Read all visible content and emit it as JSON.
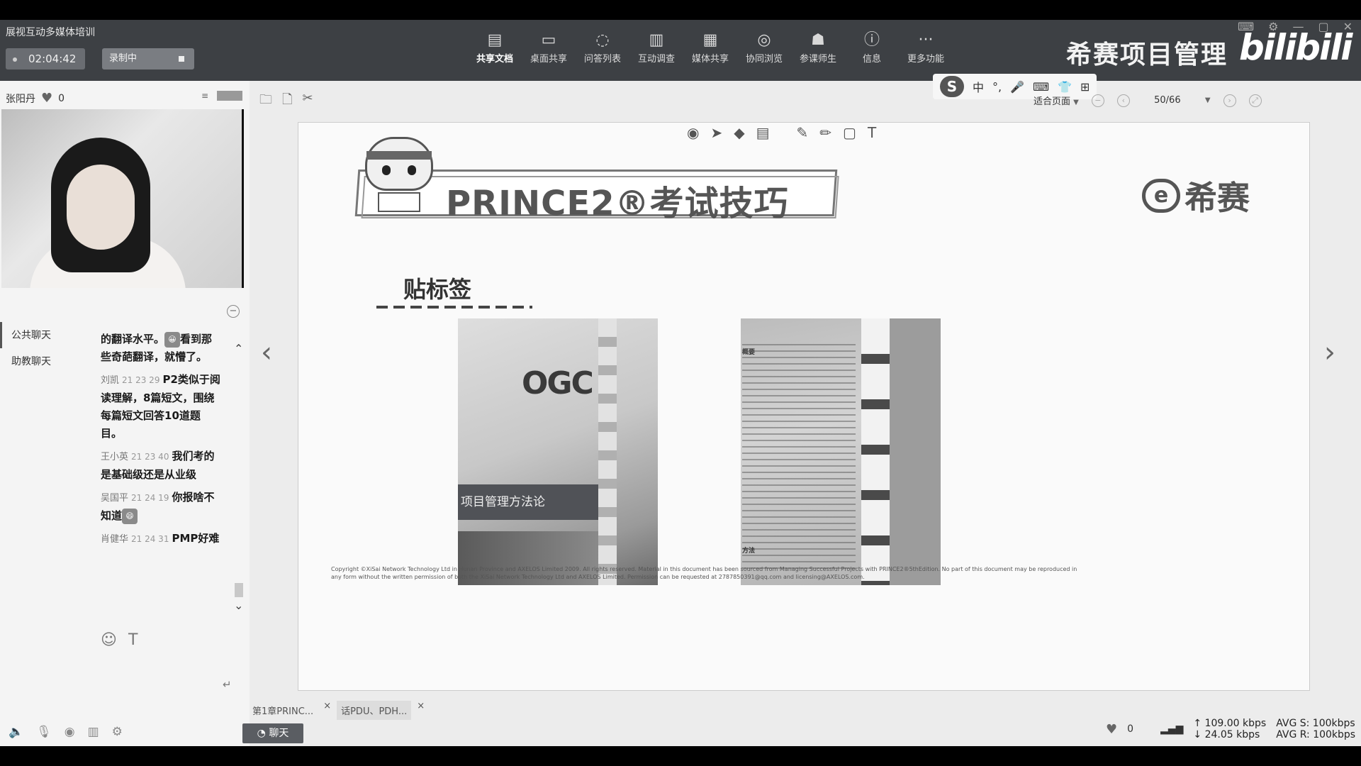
{
  "app": {
    "title": "展视互动多媒体培训",
    "timer": "02:04:42",
    "record_label": "录制中"
  },
  "toolbar": {
    "items": [
      {
        "label": "共享文档",
        "icon": "share-doc-icon",
        "glyph": "▤"
      },
      {
        "label": "桌面共享",
        "icon": "desktop-share-icon",
        "glyph": "▭"
      },
      {
        "label": "问答列表",
        "icon": "qa-list-icon",
        "glyph": "◌"
      },
      {
        "label": "互动调查",
        "icon": "survey-icon",
        "glyph": "▥"
      },
      {
        "label": "媒体共享",
        "icon": "media-share-icon",
        "glyph": "▦"
      },
      {
        "label": "协同浏览",
        "icon": "co-browse-icon",
        "glyph": "◎"
      },
      {
        "label": "参课师生",
        "icon": "participants-icon",
        "glyph": "☗"
      },
      {
        "label": "信息",
        "icon": "info-icon",
        "glyph": "ⓘ"
      },
      {
        "label": "更多功能",
        "icon": "more-icon",
        "glyph": "···"
      }
    ]
  },
  "brand": {
    "text": "希赛项目管理",
    "watermark": "bilibili"
  },
  "presenter": {
    "name": "张阳丹",
    "likes": "0"
  },
  "chat": {
    "tabs": [
      "公共聊天",
      "助教聊天"
    ],
    "messages": [
      {
        "who": "",
        "time": "",
        "text": "的翻译水平。",
        "emoji": "😀",
        "text2": "看到那些奇葩翻译，就懵了。"
      },
      {
        "who": "刘凯",
        "time": "21 23 29",
        "text": "P2类似于阅读理解，8篇短文，围绕每篇短文回答10道题目。"
      },
      {
        "who": "王小英",
        "time": "21 23 40",
        "text": "我们考的是基础级还是从业级"
      },
      {
        "who": "吴国平",
        "time": "21 24 19",
        "text": "你报啥不知道",
        "emoji": "😄"
      },
      {
        "who": "肖健华",
        "time": "21 24 31",
        "text": "PMP好难"
      }
    ]
  },
  "ime": {
    "logo": "S",
    "lang": "中",
    "items": [
      "°,",
      "🎤",
      "⌨",
      "👕",
      "⊞"
    ]
  },
  "page": {
    "fit_label": "适合页面",
    "page_indicator": "50/66"
  },
  "slide": {
    "title": "PRINCE2®考试技巧",
    "logo_text": "希赛",
    "logo_mark": "e",
    "section": "贴标签",
    "photo1_brand": "OGC",
    "photo1_band": "项目管理方法论",
    "photo2_labels": [
      "概要",
      "方法"
    ],
    "copyright": "Copyright ©XiSai Network Technology Ltd in Hunan Province and AXELOS Limited 2009. All rights reserved. Material in this document has been sourced from Managing Successful Projects with PRINCE2®5thEdition. No part of this document may be reproduced in any form without the written permission of both the XiSai Network Technology Ltd  and AXELOS Limited. Permission can be requested at 2787850391@qq.com and licensing@AXELOS.com."
  },
  "file_tabs": [
    "第1章PRINC...",
    "话PDU、PDH..."
  ],
  "chat_toggle": "聊天",
  "status": {
    "likes": "0",
    "up": "109.00 kbps",
    "down": "24.05 kbps",
    "avg_s": "AVG S: 100kbps",
    "avg_r": "AVG R: 100kbps"
  }
}
